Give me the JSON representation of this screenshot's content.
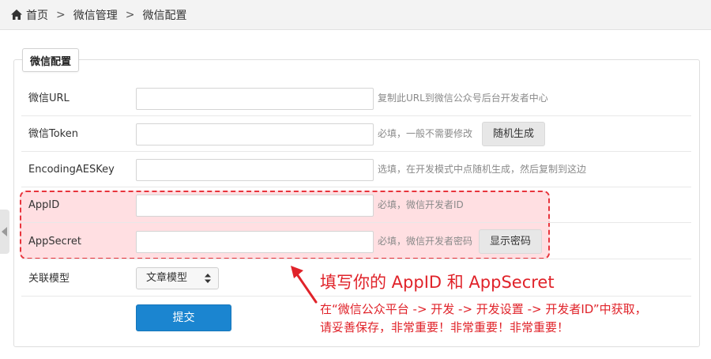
{
  "breadcrumb": {
    "home": "首页",
    "separator": ">",
    "level2": "微信管理",
    "current": "微信配置"
  },
  "panel": {
    "legend": "微信配置"
  },
  "fields": {
    "url": {
      "label": "微信URL",
      "value": "",
      "hint": "复制此URL到微信公众号后台开发者中心"
    },
    "token": {
      "label": "微信Token",
      "value": "",
      "hint": "必填，一般不需要修改",
      "button": "随机生成"
    },
    "aeskey": {
      "label": "EncodingAESKey",
      "value": "",
      "hint": "选填，在开发模式中点随机生成，然后复制到这边"
    },
    "appid": {
      "label": "AppID",
      "value": "",
      "hint": "必填，微信开发者ID"
    },
    "appsecret": {
      "label": "AppSecret",
      "value": "",
      "hint": "必填，微信开发者密码",
      "button": "显示密码"
    },
    "model": {
      "label": "关联模型",
      "selected": "文章模型"
    }
  },
  "submit_label": "提交",
  "annotation": {
    "title": "填写你的 AppID 和 AppSecret",
    "line1": "在“微信公众平台 -> 开发 -> 开发设置 -> 开发者ID”中获取，",
    "line2": "请妥善保存，非常重要！非常重要！非常重要！"
  },
  "colors": {
    "accent": "#1b85d0",
    "annotation": "#e0232a",
    "highlight_fill": "#fde0e2"
  }
}
